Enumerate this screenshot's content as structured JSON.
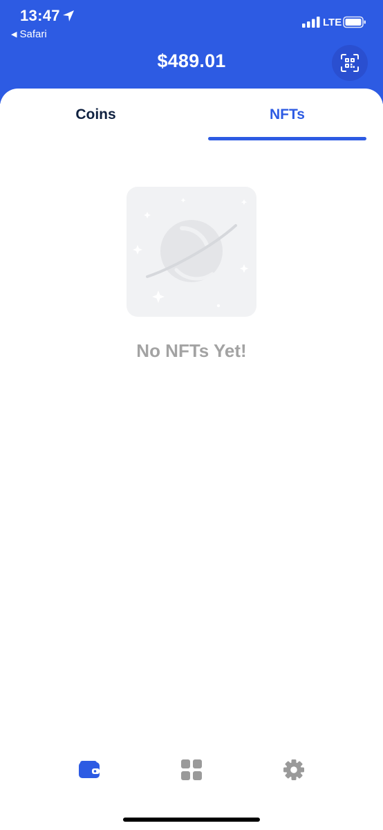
{
  "status_bar": {
    "time": "13:47",
    "back_app": "Safari",
    "network": "LTE"
  },
  "header": {
    "balance": "$489.01",
    "qr_icon": "qr-scan-icon"
  },
  "tabs": [
    {
      "label": "Coins",
      "selected": false
    },
    {
      "label": "NFTs",
      "selected": true
    }
  ],
  "empty_state": {
    "icon": "planet-icon",
    "message": "No NFTs Yet!"
  },
  "bottom_nav": [
    {
      "icon": "wallet-icon",
      "active": true
    },
    {
      "icon": "grid-icon",
      "active": false
    },
    {
      "icon": "gear-icon",
      "active": false
    }
  ],
  "colors": {
    "brand": "#2d5be3",
    "tab_inactive": "#0f2140",
    "muted_text": "#a3a3a3",
    "nav_inactive": "#9a9a9a"
  }
}
